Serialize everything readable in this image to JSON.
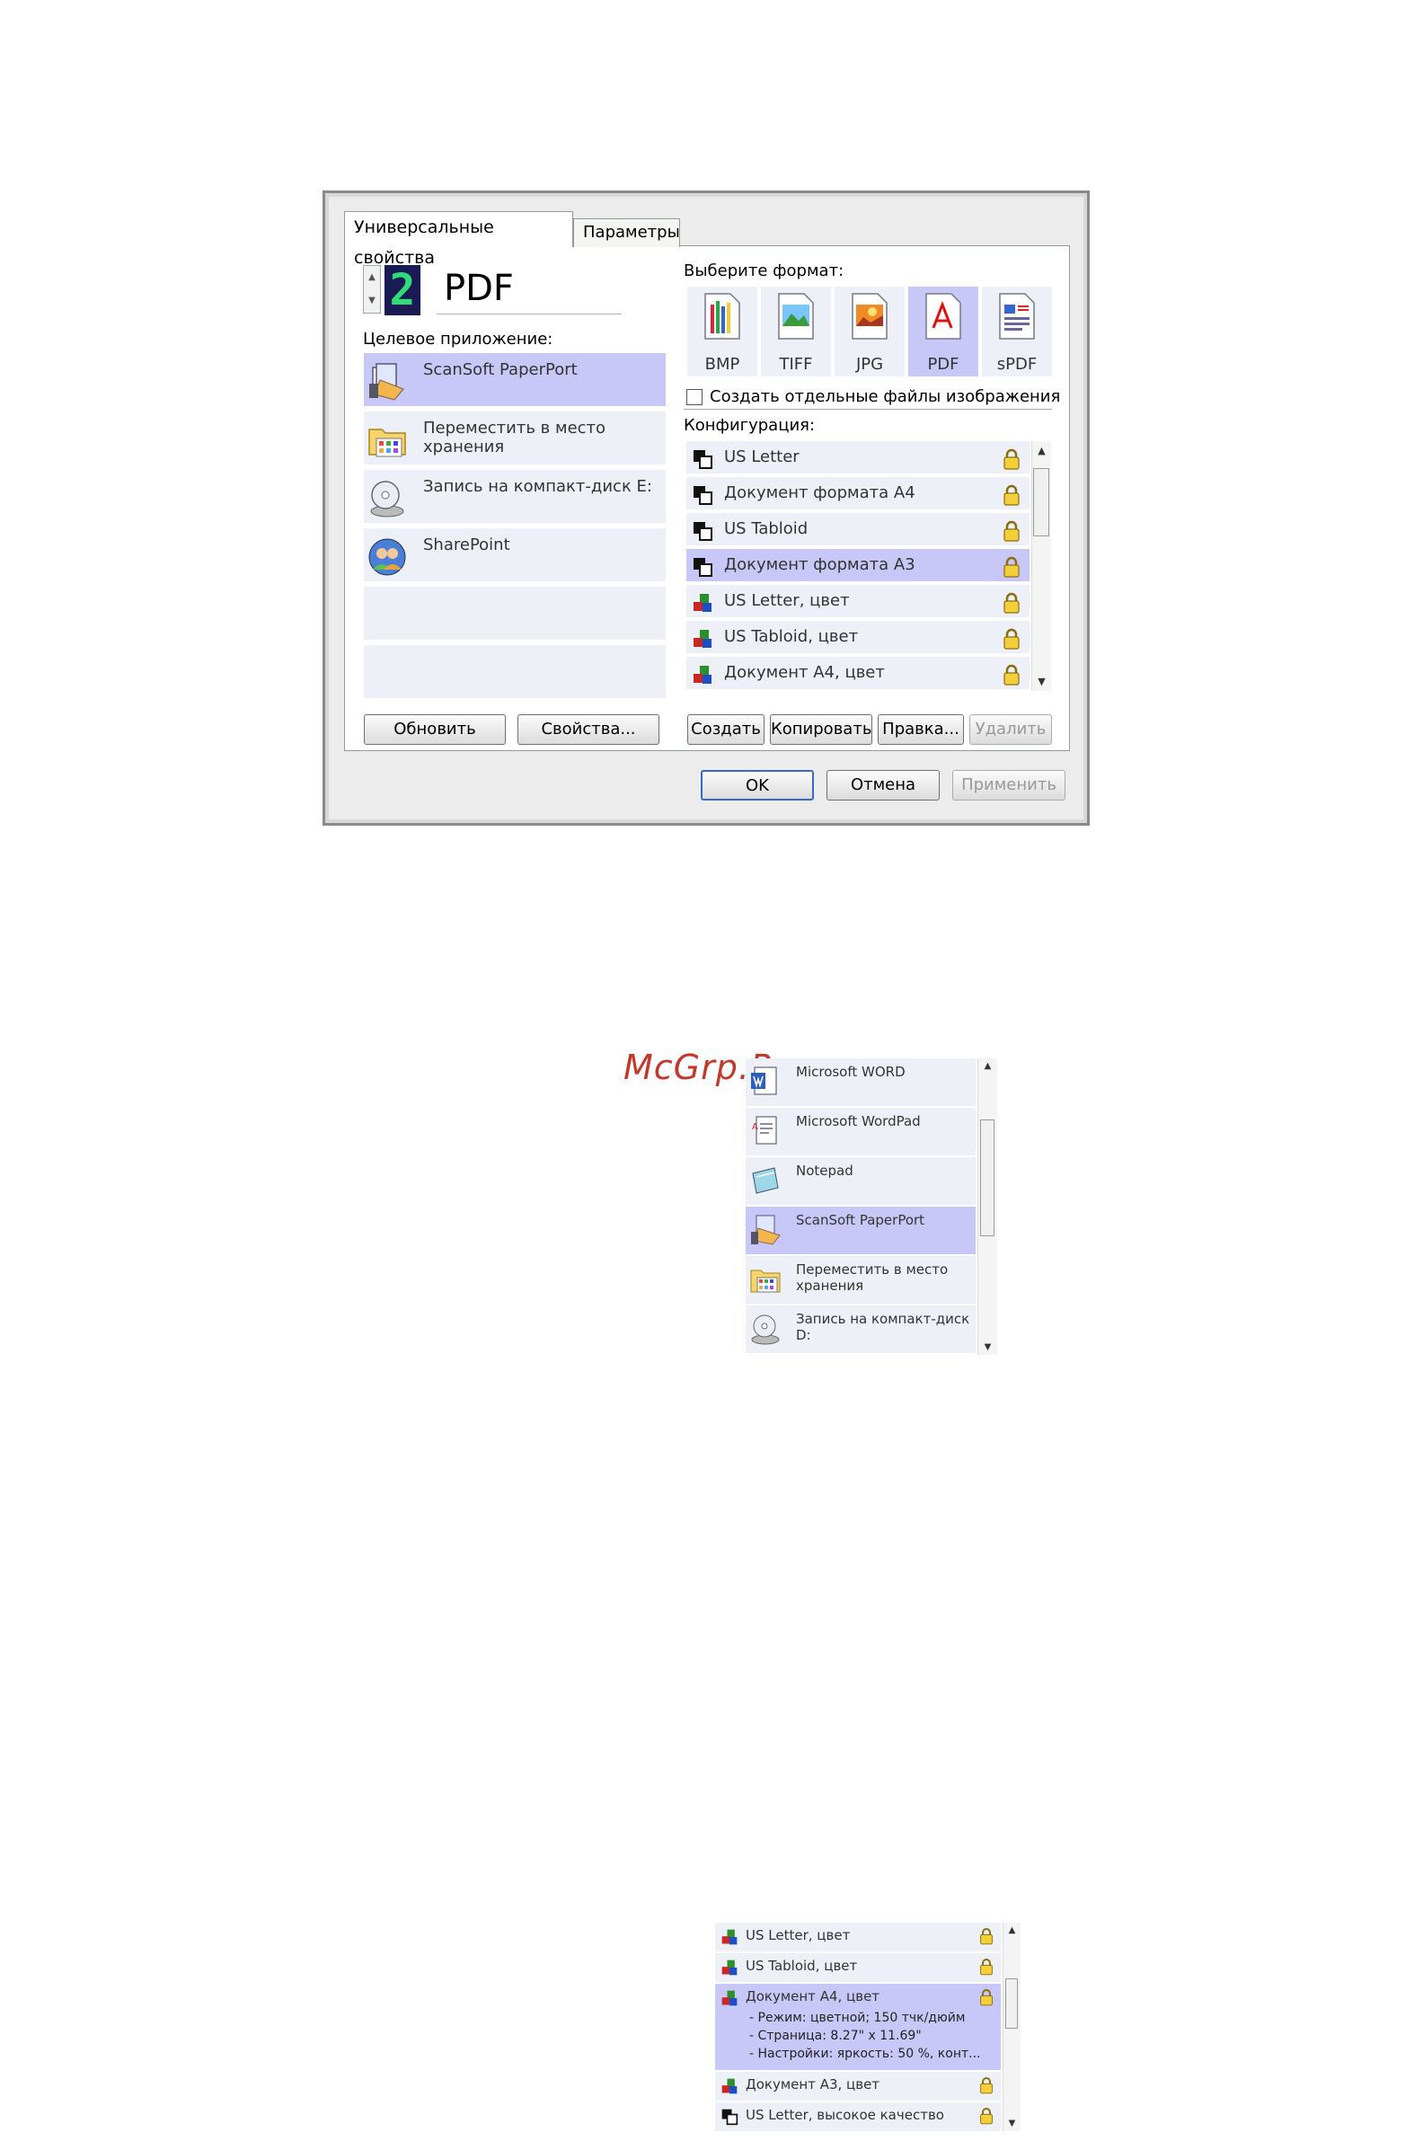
{
  "watermark": "McGrp.Ru",
  "dialog": {
    "tabs": [
      "Универсальные свойства",
      "Параметры"
    ],
    "format_number": "2",
    "format_name": "PDF",
    "target_label": "Целевое приложение:",
    "targets": [
      {
        "label": "ScanSoft PaperPort",
        "icon": "paperport-icon",
        "selected": true
      },
      {
        "label": "Переместить в место хранения",
        "icon": "folder-icon",
        "selected": false
      },
      {
        "label": "Запись на компакт-диск  E:",
        "icon": "cd-burn-icon",
        "selected": false
      },
      {
        "label": "SharePoint",
        "icon": "sharepoint-icon",
        "selected": false
      },
      {
        "label": "",
        "icon": "",
        "selected": false
      },
      {
        "label": "",
        "icon": "",
        "selected": false
      }
    ],
    "format_label": "Выберите формат:",
    "formats": [
      {
        "label": "BMP",
        "icon": "bmp-icon",
        "selected": false
      },
      {
        "label": "TIFF",
        "icon": "tiff-icon",
        "selected": false
      },
      {
        "label": "JPG",
        "icon": "jpg-icon",
        "selected": false
      },
      {
        "label": "PDF",
        "icon": "pdf-icon",
        "selected": true
      },
      {
        "label": "sPDF",
        "icon": "spdf-icon",
        "selected": false
      }
    ],
    "separate_files_label": "Создать отдельные файлы изображения",
    "config_label": "Конфигурация:",
    "configs": [
      {
        "label": "US Letter",
        "type": "bw",
        "selected": false
      },
      {
        "label": "Документ формата A4",
        "type": "bw",
        "selected": false
      },
      {
        "label": "US Tabloid",
        "type": "bw",
        "selected": false
      },
      {
        "label": "Документ формата A3",
        "type": "bw",
        "selected": true
      },
      {
        "label": "US Letter, цвет",
        "type": "color",
        "selected": false
      },
      {
        "label": "US Tabloid, цвет",
        "type": "color",
        "selected": false
      },
      {
        "label": "Документ A4, цвет",
        "type": "color",
        "selected": false
      }
    ],
    "buttons": {
      "refresh": "Обновить",
      "properties": "Свойства...",
      "create": "Создать",
      "copy": "Копировать",
      "edit": "Правка...",
      "delete": "Удалить",
      "ok": "OK",
      "cancel": "Отмена",
      "apply": "Применить"
    }
  },
  "app_list": [
    {
      "label": "Microsoft WORD",
      "icon": "word-icon",
      "selected": false
    },
    {
      "label": "Microsoft WordPad",
      "icon": "wordpad-icon",
      "selected": false
    },
    {
      "label": "Notepad",
      "icon": "notepad-icon",
      "selected": false
    },
    {
      "label": "ScanSoft PaperPort",
      "icon": "paperport-icon",
      "selected": true
    },
    {
      "label": "Переместить в место хранения",
      "icon": "folder-icon",
      "selected": false
    },
    {
      "label": "Запись на компакт-диск D:",
      "icon": "cd-burn-icon",
      "selected": false
    }
  ],
  "config_list": {
    "items": [
      {
        "label": "US Letter, цвет",
        "type": "color",
        "selected": false
      },
      {
        "label": "US Tabloid, цвет",
        "type": "color",
        "selected": false
      },
      {
        "label": "Документ A4, цвет",
        "type": "color",
        "selected": true,
        "details": [
          "- Режим: цветной; 150 тчк/дюйм",
          "- Страница:  8.27\" x 11.69\"",
          "- Настройки: яркость: 50 %, конт..."
        ]
      },
      {
        "label": "Документ A3, цвет",
        "type": "color",
        "selected": false
      },
      {
        "label": "US Letter, высокое качество",
        "type": "bw",
        "selected": false
      }
    ]
  },
  "colors": {
    "selection": "#c8c8f8",
    "item": "#eef0f8",
    "watermark": "#c0392b"
  }
}
